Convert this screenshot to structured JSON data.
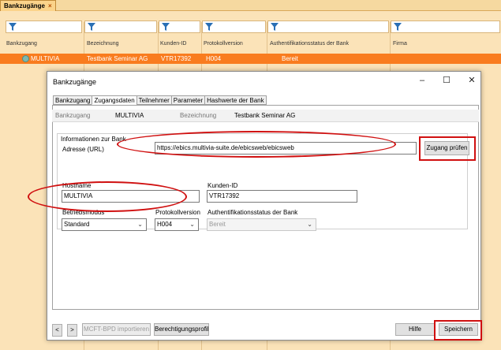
{
  "app": {
    "tab_label": "Bankzugänge",
    "tab_close": "×",
    "columns": [
      "Bankzugang",
      "Bezeichnung",
      "Kunden-ID",
      "Protokollversion",
      "Authentifikationsstatus der Bank",
      "Firma"
    ],
    "selected_row": {
      "bankzugang": "MULTIVIA",
      "bezeichnung": "Testbank Seminar AG",
      "kunden_id": "VTR17392",
      "protokoll": "H004",
      "status": "Bereit"
    },
    "colors": {
      "selected_row": "#f97c1f",
      "tabbar": "#f6d9a0",
      "grid": "#fbe3b8"
    }
  },
  "dialog": {
    "title": "Bankzugänge",
    "window_buttons": {
      "minimize": "–",
      "maximize": "☐",
      "close": "✕"
    },
    "tabs": [
      "Bankzugang",
      "Zugangsdaten",
      "Teilnehmer",
      "Parameter",
      "Hashwerte der Bank"
    ],
    "active_tab": "Zugangsdaten",
    "header": {
      "bankzugang_label": "Bankzugang",
      "bankzugang_value": "MULTIVIA",
      "bezeichnung_label": "Bezeichnung",
      "bezeichnung_value": "Testbank Seminar AG"
    },
    "info_group": {
      "title": "Informationen zur Bank",
      "address_label": "Adresse (URL)",
      "help_label": "?",
      "url_value": "https://ebics.multivia-suite.de/ebicsweb/ebicsweb",
      "check_button": "Zugang prüfen"
    },
    "hostname": {
      "label": "Hostname",
      "value": "MULTIVIA"
    },
    "kunden_id": {
      "label": "Kunden-ID",
      "value": "VTR17392"
    },
    "betriebsmodus": {
      "label": "Betriebsmodus",
      "value": "Standard"
    },
    "protokollversion": {
      "label": "Protokollversion",
      "value": "H004"
    },
    "auth_status": {
      "label": "Authentifikationsstatus der Bank",
      "value": "Bereit"
    },
    "footer": {
      "prev": "<",
      "next": ">",
      "import_button": "MCFT-BPD importieren",
      "rights_button": "Berechtigungsprofil",
      "help_button": "Hilfe",
      "save_button": "Speichern"
    },
    "highlight_color": "#d01010"
  }
}
